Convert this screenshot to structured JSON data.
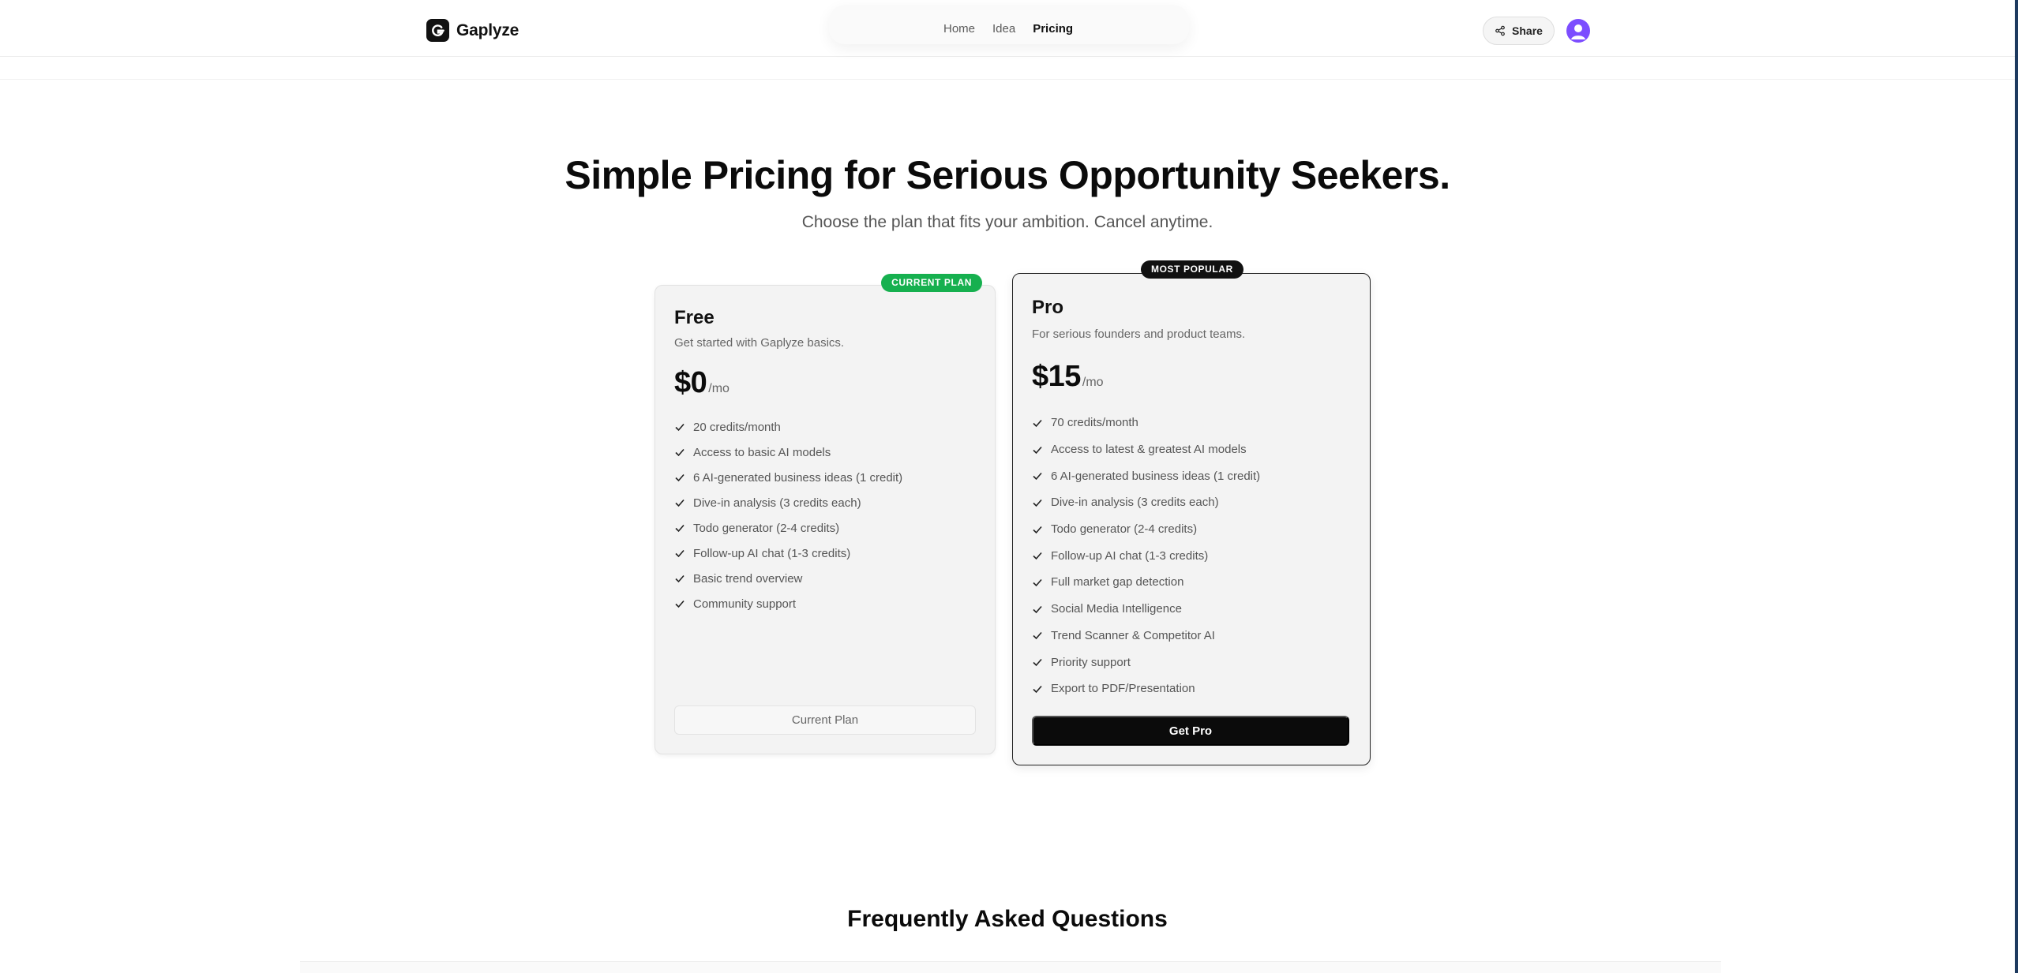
{
  "header": {
    "brand": "Gaplyze",
    "nav": [
      {
        "label": "Home",
        "active": false
      },
      {
        "label": "Idea",
        "active": false
      },
      {
        "label": "Pricing",
        "active": true
      }
    ],
    "share_label": "Share"
  },
  "hero": {
    "title": "Simple Pricing for Serious Opportunity Seekers.",
    "subtitle": "Choose the plan that fits your ambition. Cancel anytime."
  },
  "plans": {
    "free": {
      "badge": "CURRENT PLAN",
      "name": "Free",
      "description": "Get started with Gaplyze basics.",
      "price": "$0",
      "period": "/mo",
      "features": [
        "20 credits/month",
        "Access to basic AI models",
        "6 AI-generated business ideas (1 credit)",
        "Dive-in analysis (3 credits each)",
        "Todo generator (2-4 credits)",
        "Follow-up AI chat (1-3 credits)",
        "Basic trend overview",
        "Community support"
      ],
      "button_label": "Current Plan"
    },
    "pro": {
      "badge": "MOST POPULAR",
      "name": "Pro",
      "description": "For serious founders and product teams.",
      "price": "$15",
      "period": "/mo",
      "features": [
        "70 credits/month",
        "Access to latest & greatest AI models",
        "6 AI-generated business ideas (1 credit)",
        "Dive-in analysis (3 credits each)",
        "Todo generator (2-4 credits)",
        "Follow-up AI chat (1-3 credits)",
        "Full market gap detection",
        "Social Media Intelligence",
        "Trend Scanner & Competitor AI",
        "Priority support",
        "Export to PDF/Presentation"
      ],
      "button_label": "Get Pro"
    }
  },
  "faq": {
    "title": "Frequently Asked Questions"
  },
  "colors": {
    "current_badge": "#16b04f",
    "popular_badge": "#111111",
    "primary_button": "#0b0b0b",
    "avatar": "#7c4dff"
  },
  "icons": {
    "logo": "gaplyze-logo-icon",
    "share": "share-icon",
    "avatar": "user-avatar-icon",
    "feature": "check-icon"
  }
}
